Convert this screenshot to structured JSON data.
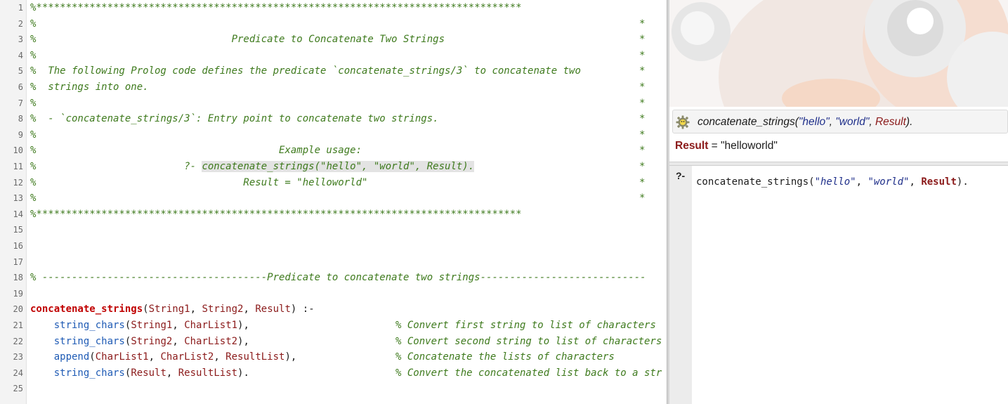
{
  "editor": {
    "line_numbers": [
      "1",
      "2",
      "3",
      "4",
      "5",
      "6",
      "7",
      "8",
      "9",
      "10",
      "11",
      "12",
      "13",
      "14",
      "15",
      "16",
      "17",
      "18",
      "19",
      "20",
      "21",
      "22",
      "23",
      "24",
      "25"
    ],
    "header_border": "%**********************************************************************************",
    "header_lines": [
      {
        "text": "%",
        "end": "*"
      },
      {
        "text": "%                                 Predicate to Concatenate Two Strings",
        "end": "*"
      },
      {
        "text": "%",
        "end": "*"
      },
      {
        "text": "%  The following Prolog code defines the predicate `concatenate_strings/3` to concatenate two",
        "end": "*"
      },
      {
        "text": "%  strings into one.",
        "end": "*"
      },
      {
        "text": "%",
        "end": "*"
      },
      {
        "text": "%  - `concatenate_strings/3`: Entry point to concatenate two strings.",
        "end": "*"
      },
      {
        "text": "%",
        "end": "*"
      },
      {
        "text": "%                                         Example usage:",
        "end": "*"
      },
      {
        "text": "%                         ?- ",
        "hl": "concatenate_strings(\"hello\", \"world\", Result).",
        "end": "*"
      },
      {
        "text": "%                                   Result = \"helloworld\"",
        "end": "*"
      },
      {
        "text": "%",
        "end": "*"
      }
    ],
    "section_comment": "% --------------------------------------Predicate to concatenate two strings----------------------------",
    "clause_head": {
      "name": "concatenate_strings",
      "args": [
        "String1",
        "String2",
        "Result"
      ],
      "neck": " :-"
    },
    "body": [
      {
        "pred": "string_chars",
        "args": [
          "String1",
          "CharList1"
        ],
        "end": "),",
        "comment": "% Convert first string to list of characters"
      },
      {
        "pred": "string_chars",
        "args": [
          "String2",
          "CharList2"
        ],
        "end": "),",
        "comment": "% Convert second string to list of characters"
      },
      {
        "pred": "append",
        "args": [
          "CharList1",
          "CharList2",
          "ResultList"
        ],
        "end": "),",
        "comment": "% Concatenate the lists of characters"
      },
      {
        "pred": "string_chars",
        "args": [
          "Result",
          "ResultList"
        ],
        "end": ").",
        "comment": "% Convert the concatenated list back to a str"
      }
    ]
  },
  "answer": {
    "query_pred": "concatenate_strings",
    "query_open": "(",
    "query_str1": "\"hello\"",
    "query_str2": "\"world\"",
    "query_var": "Result",
    "query_close": ").",
    "comma": ", ",
    "result_var": "Result",
    "result_eq": " = ",
    "result_value": "\"helloworld\""
  },
  "query_editor": {
    "prompt": "?-",
    "pred": "concatenate_strings(",
    "str1": "\"hello\"",
    "str2": "\"world\"",
    "var": "Result",
    "close": ").",
    "comma": ", "
  },
  "colors": {
    "comment": "#3e7a1d",
    "predicate_head": "#c00000",
    "builtin": "#1f5bb5",
    "variable": "#8b1a1a",
    "string": "#1f2f8a"
  },
  "icons": {
    "answer_gear": "gear-icon"
  }
}
